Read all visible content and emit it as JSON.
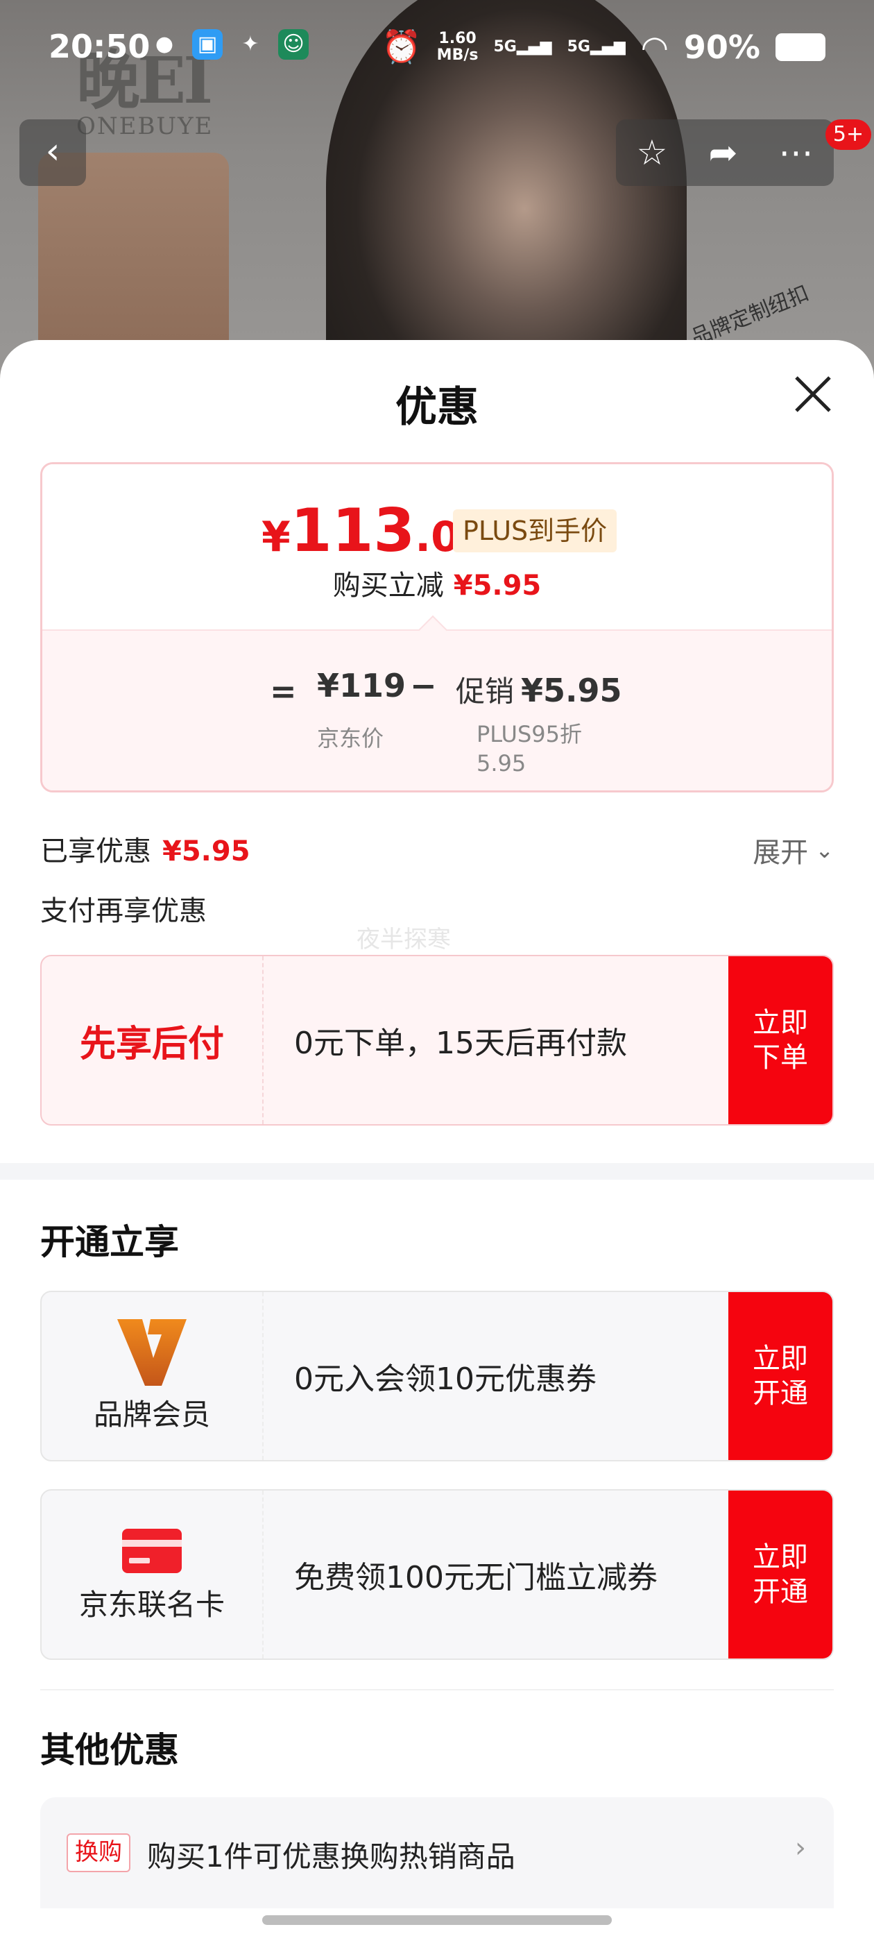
{
  "status_bar": {
    "time": "20:50",
    "net_speed_top": "1.60",
    "net_speed_bottom": "MB/s",
    "sig1": "5G",
    "sig2": "5G",
    "battery": "90%"
  },
  "background": {
    "brand_cn": "晚EI",
    "brand_en": "ONEBUYE",
    "tag": "品牌定制纽扣"
  },
  "nav": {
    "badge": "5+"
  },
  "sheet": {
    "title": "优惠"
  },
  "price_card": {
    "currency": "¥",
    "price_int": "113",
    "price_dec": ".05",
    "plus_tag": "PLUS到手价",
    "instant_label": "购买立减",
    "instant_amount": "¥5.95",
    "eq": "=",
    "jd_price": "¥119",
    "minus": "−",
    "promo_label": "促销",
    "promo_amount": "¥5.95",
    "jd_label": "京东价",
    "plus_label_1": "PLUS95折",
    "plus_label_2": "5.95"
  },
  "enjoyed": {
    "label": "已享优惠",
    "amount": "¥5.95",
    "expand": "展开"
  },
  "pay_section": {
    "title": "支付再享优惠",
    "watermark": "夜半探寒",
    "offer": {
      "left": "先享后付",
      "desc": "0元下单，15天后再付款",
      "button": "立即\n下单"
    }
  },
  "open_section": {
    "title": "开通立享",
    "offers": [
      {
        "left": "品牌会员",
        "desc": "0元入会领10元优惠券",
        "button": "立即\n开通"
      },
      {
        "left": "京东联名卡",
        "desc": "免费领100元无门槛立减券",
        "button": "立即\n开通"
      }
    ]
  },
  "other_section": {
    "title": "其他优惠",
    "tag": "换购",
    "text": "购买1件可优惠换购热销商品"
  },
  "colors": {
    "accent": "#e8141a",
    "button": "#f5040f"
  }
}
